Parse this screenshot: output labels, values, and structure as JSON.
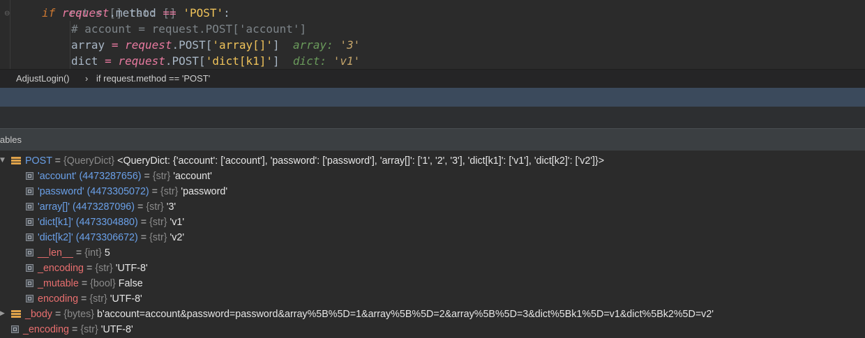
{
  "editor": {
    "line0": {
      "text": "rst = [] rst: []"
    },
    "line1": {
      "kw": "if",
      "var": "request",
      "rest": ".method ",
      "op": "==",
      "sp": " ",
      "str": "'POST'",
      "colon": ":"
    },
    "line2": {
      "comment": "# account = request.POST['account']"
    },
    "line3": {
      "lhs": "array",
      "eq": "=",
      "var": "request",
      "mid": ".POST[",
      "str": "'array[]'",
      "close": "]",
      "hint_name": "array:",
      "hint_val": "'3'"
    },
    "line4": {
      "lhs": "dict",
      "eq": "=",
      "var": "request",
      "mid": ".POST[",
      "str": "'dict[k1]'",
      "close": "]",
      "hint_name": "dict:",
      "hint_val": "'v1'"
    }
  },
  "breadcrumb": {
    "func": "AdjustLogin()",
    "separator": "›",
    "stmt": "if request.method == 'POST'"
  },
  "variables_panel": {
    "title": "iables"
  },
  "tree": [
    {
      "name": "POST",
      "type": "{QueryDict}",
      "value": "<QueryDict: {'account': ['account'], 'password': ['password'], 'array[]': ['1', '2', '3'], 'dict[k1]': ['v1'], 'dict[k2]': ['v2']}>"
    },
    {
      "name": "'account' (4473287656)",
      "type": "{str}",
      "value": "'account'"
    },
    {
      "name": "'password' (4473305072)",
      "type": "{str}",
      "value": "'password'"
    },
    {
      "name": "'array[]' (4473287096)",
      "type": "{str}",
      "value": "'3'"
    },
    {
      "name": "'dict[k1]' (4473304880)",
      "type": "{str}",
      "value": "'v1'"
    },
    {
      "name": "'dict[k2]' (4473306672)",
      "type": "{str}",
      "value": "'v2'"
    },
    {
      "name": "__len__",
      "type": "{int}",
      "value": "5"
    },
    {
      "name": "_encoding",
      "type": "{str}",
      "value": "'UTF-8'"
    },
    {
      "name": "_mutable",
      "type": "{bool}",
      "value": "False"
    },
    {
      "name": "encoding",
      "type": "{str}",
      "value": "'UTF-8'"
    },
    {
      "name": "_body",
      "type": "{bytes}",
      "value": "b'account=account&password=password&array%5B%5D=1&array%5B%5D=2&array%5B%5D=3&dict%5Bk1%5D=v1&dict%5Bk2%5D=v2'"
    },
    {
      "name": "_encoding",
      "type": "{str}",
      "value": "'UTF-8'"
    }
  ],
  "icons": {
    "expanded": "triangle-down-icon",
    "collapsed": "triangle-right-icon",
    "field": "field-icon",
    "object": "stack-icon"
  },
  "colors": {
    "background": "#2b2b2b",
    "toolbar": "#3b4a5c",
    "keyword": "#cc7832",
    "string": "#f0c35a",
    "blue_name": "#6aa0e8",
    "red_name": "#e86f6f"
  }
}
